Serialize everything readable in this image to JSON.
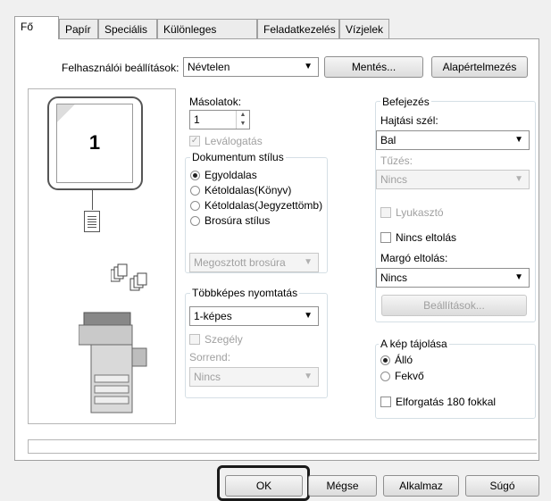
{
  "tabs": [
    {
      "label": "Fő",
      "active": true
    },
    {
      "label": "Papír"
    },
    {
      "label": "Speciális"
    },
    {
      "label": "Különleges módok"
    },
    {
      "label": "Feladatkezelés"
    },
    {
      "label": "Vízjelek"
    }
  ],
  "user_settings": {
    "label": "Felhasználói beállítások:",
    "value": "Névtelen",
    "save_label": "Mentés...",
    "default_label": "Alapértelmezés"
  },
  "preview": {
    "page_number": "1"
  },
  "copies": {
    "label": "Másolatok:",
    "value": "1"
  },
  "collate": {
    "label": "Leválogatás",
    "checked": true,
    "enabled": false
  },
  "document_style": {
    "label": "Dokumentum stílus",
    "options": [
      "Egyoldalas",
      "Kétoldalas(Könyv)",
      "Kétoldalas(Jegyzettömb)",
      "Brosúra stílus"
    ],
    "selected": "Egyoldalas",
    "split_booklet": "Megosztott brosúra"
  },
  "n_up": {
    "label": "Többképes nyomtatás",
    "value": "1-képes",
    "border_label": "Szegély",
    "order_label": "Sorrend:",
    "order_value": "Nincs"
  },
  "finishing": {
    "label": "Befejezés",
    "binding_edge_label": "Hajtási szél:",
    "binding_edge_value": "Bal",
    "staple_label": "Tűzés:",
    "staple_value": "Nincs",
    "punch_label": "Lyukasztó",
    "no_offset_label": "Nincs eltolás",
    "margin_shift_label": "Margó eltolás:",
    "margin_shift_value": "Nincs",
    "settings_button": "Beállítások..."
  },
  "orientation": {
    "label": "A kép tájolása",
    "options": [
      "Álló",
      "Fekvő"
    ],
    "selected": "Álló",
    "rotate_label": "Elforgatás 180 fokkal"
  },
  "footer": {
    "ok": "OK",
    "cancel": "Mégse",
    "apply": "Alkalmaz",
    "help": "Súgó"
  },
  "colors": {
    "highlight": "#1a1a1a",
    "accent": "#3399ff"
  }
}
